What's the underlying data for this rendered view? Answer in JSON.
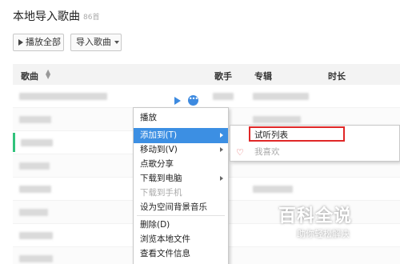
{
  "header": {
    "title": "本地导入歌曲",
    "count": "86首"
  },
  "toolbar": {
    "play_all_label": "播放全部",
    "import_label": "导入歌曲"
  },
  "table": {
    "columns": {
      "song": "歌曲",
      "singer": "歌手",
      "album": "专辑",
      "duration": "时长"
    }
  },
  "context_menu": {
    "items": [
      {
        "label": "播放",
        "state": "normal"
      },
      {
        "label": "添加到(T)",
        "state": "active",
        "submenu": true
      },
      {
        "label": "移动到(V)",
        "state": "normal",
        "submenu": true
      },
      {
        "label": "点歌分享",
        "state": "normal"
      },
      {
        "label": "下载到电脑",
        "state": "normal",
        "submenu": true
      },
      {
        "label": "下载到手机",
        "state": "disabled"
      },
      {
        "label": "设为空间背景音乐",
        "state": "normal"
      },
      {
        "label": "删除(D)",
        "state": "normal"
      },
      {
        "label": "浏览本地文件",
        "state": "normal"
      },
      {
        "label": "查看文件信息",
        "state": "normal"
      }
    ]
  },
  "submenu": {
    "trial_list": "试听列表",
    "favorites": "我喜欢"
  },
  "watermark": {
    "title": "百科全说",
    "subtitle": "助你轻松解决"
  },
  "colors": {
    "accent": "#3c8fe3",
    "highlight_box": "#e02727",
    "heart": "#e05a5a",
    "selected_marker": "#31c27c"
  },
  "icons": {
    "play_all": "play-triangle-icon",
    "import_dropdown": "chevron-down-icon",
    "sort": "sort-icon",
    "row_play": "play-icon",
    "row_more": "more-icon",
    "favorite": "heart-icon"
  }
}
